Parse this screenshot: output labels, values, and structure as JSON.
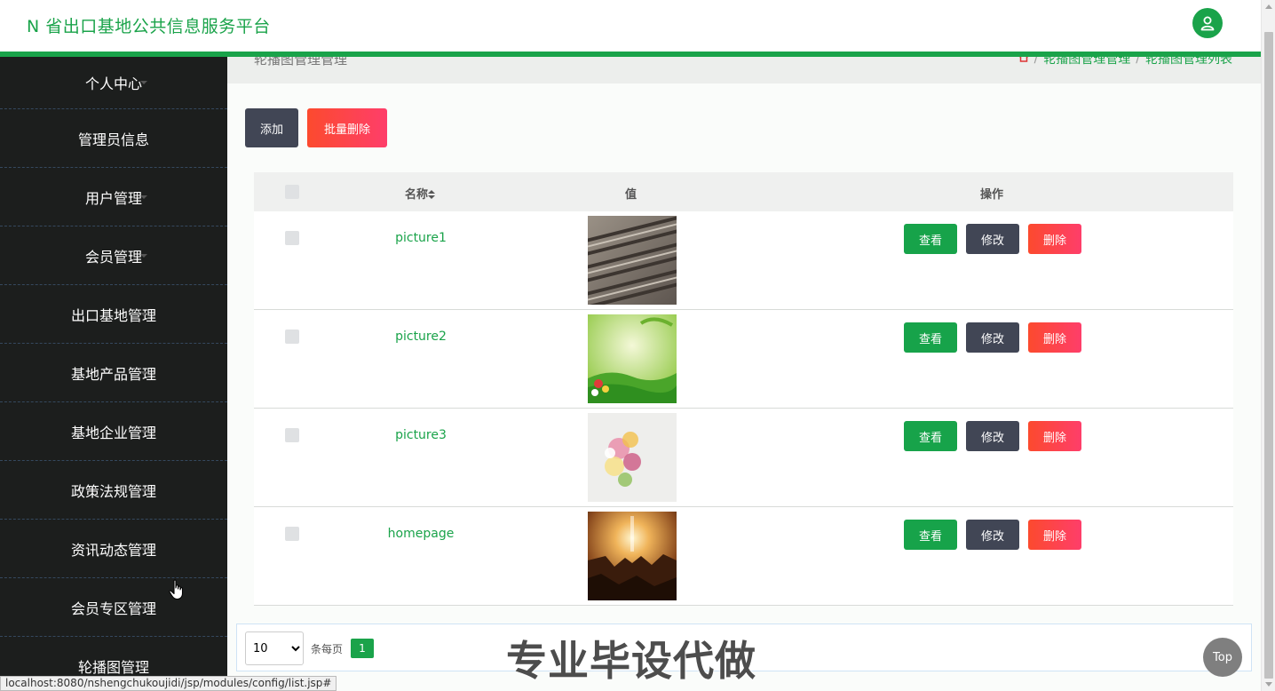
{
  "app": {
    "title": "N 省出口基地公共信息服务平台"
  },
  "sidebar": {
    "items": [
      {
        "label": "个人中心",
        "has_caret": true
      },
      {
        "label": "管理员信息",
        "has_caret": true
      },
      {
        "label": "用户管理",
        "has_caret": true
      },
      {
        "label": "会员管理",
        "has_caret": true
      },
      {
        "label": "出口基地管理",
        "has_caret": true
      },
      {
        "label": "基地产品管理",
        "has_caret": true
      },
      {
        "label": "基地企业管理",
        "has_caret": true
      },
      {
        "label": "政策法规管理",
        "has_caret": true
      },
      {
        "label": "资讯动态管理",
        "has_caret": true
      },
      {
        "label": "会员专区管理",
        "has_caret": true
      },
      {
        "label": "轮播图管理",
        "has_caret": true
      }
    ]
  },
  "breadcrumb": {
    "page_title": "轮播图管理管理",
    "items": [
      "轮播图管理管理",
      "轮播图管理列表"
    ],
    "home_icon": "home-icon",
    "separator": "/"
  },
  "toolbar": {
    "add_label": "添加",
    "batch_delete_label": "批量删除"
  },
  "table": {
    "headers": {
      "name": "名称",
      "value": "值",
      "ops": "操作"
    },
    "rows": [
      {
        "name": "picture1",
        "thumb": "rail-tracks"
      },
      {
        "name": "picture2",
        "thumb": "green-flowers"
      },
      {
        "name": "picture3",
        "thumb": "flower-bouquet"
      },
      {
        "name": "homepage",
        "thumb": "canyon-sunrise"
      }
    ],
    "op_labels": {
      "view": "查看",
      "edit": "修改",
      "delete": "删除"
    }
  },
  "pagination": {
    "page_size": "10",
    "page_size_options": [
      "10"
    ],
    "per_page_label": "条每页",
    "current_page": "1"
  },
  "overlay": {
    "watermark": "专业毕设代做",
    "top_button": "Top"
  },
  "status_bar": {
    "url": "localhost:8080/nshengchukoujidi/jsp/modules/config/list.jsp#"
  },
  "colors": {
    "primary": "#1aa34a",
    "sidebar_bg": "#1c1e1d",
    "danger": "#fe3e4e",
    "dark_button": "#414655"
  }
}
